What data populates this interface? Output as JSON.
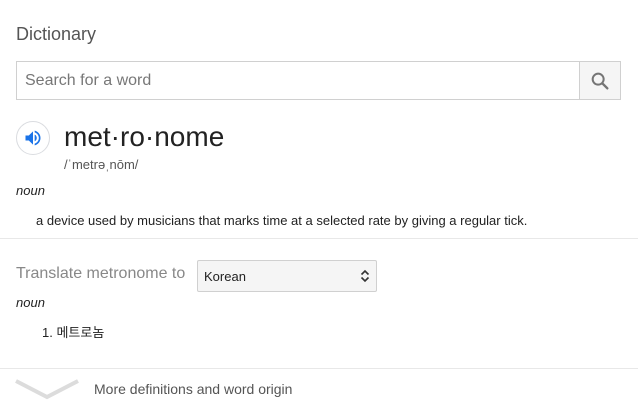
{
  "dictionary": {
    "title": "Dictionary",
    "search": {
      "placeholder": "Search for a word",
      "value": ""
    },
    "entry": {
      "headword": "met·ro·nome",
      "pronunciation": "/ˈmetrəˌnōm/",
      "part_of_speech": "noun",
      "definition": "a device used by musicians that marks time at a selected rate by giving a regular tick."
    },
    "translate": {
      "label": "Translate metronome to",
      "selected_language": "Korean",
      "part_of_speech": "noun",
      "items": [
        {
          "number": "1.",
          "text": "메트로놈"
        }
      ]
    },
    "more_label": "More definitions and word origin"
  },
  "colors": {
    "accent_blue": "#1a73e8",
    "icon_grey": "#757575"
  },
  "icons": {
    "search": "search-icon",
    "speaker": "speaker-icon",
    "dropdown": "updown-arrows-icon",
    "more": "chevron-down-icon"
  }
}
